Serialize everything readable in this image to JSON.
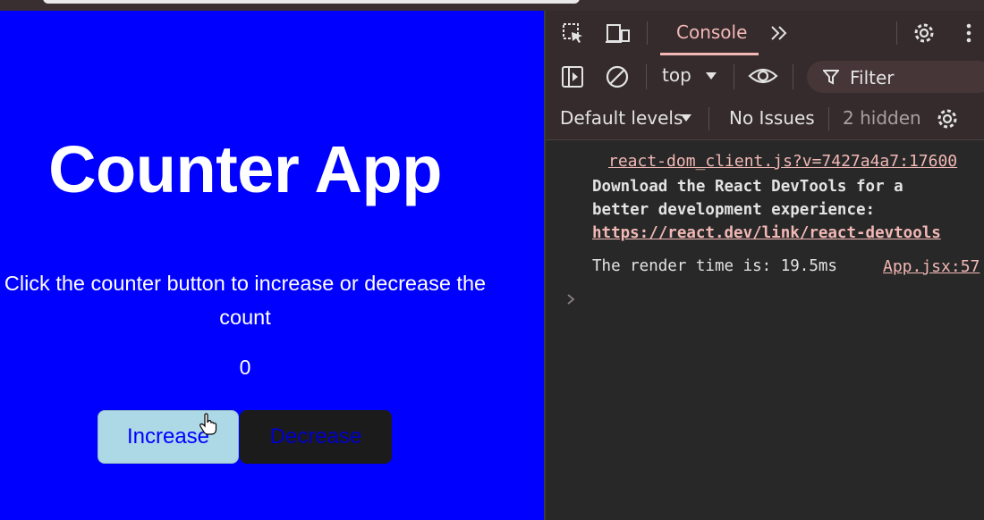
{
  "app": {
    "title": "Counter App",
    "description": "Click the counter button to increase or decrease the count",
    "count": "0",
    "increase_label": "Increase",
    "decrease_label": "Decrease"
  },
  "devtools": {
    "tab_console": "Console",
    "context": "top",
    "filter_placeholder": "Filter",
    "levels_label": "Default levels",
    "issues_label": "No Issues",
    "hidden_label": "2 hidden",
    "messages": [
      {
        "source": "react-dom_client.js?v=7427a4a7:17600",
        "line1": "Download the React DevTools for a",
        "line2": "better development experience:",
        "link": "https://react.dev/link/react-devtools"
      },
      {
        "text": "The render time is: 19.5ms",
        "source": "App.jsx:57"
      }
    ]
  },
  "colors": {
    "app_bg": "#0000ff",
    "increase_bg": "#add8e6",
    "decrease_bg": "#1b1b1b",
    "devtools_bg": "#282828",
    "accent": "#f2b8b5"
  },
  "icons": [
    "inspect-element-icon",
    "device-toggle-icon",
    "more-tabs-icon",
    "settings-gear-icon",
    "kebab-menu-icon",
    "sidebar-toggle-icon",
    "clear-console-icon",
    "dropdown-arrow-icon",
    "eye-icon",
    "filter-icon",
    "console-settings-icon",
    "console-prompt-icon",
    "hand-cursor-icon"
  ]
}
